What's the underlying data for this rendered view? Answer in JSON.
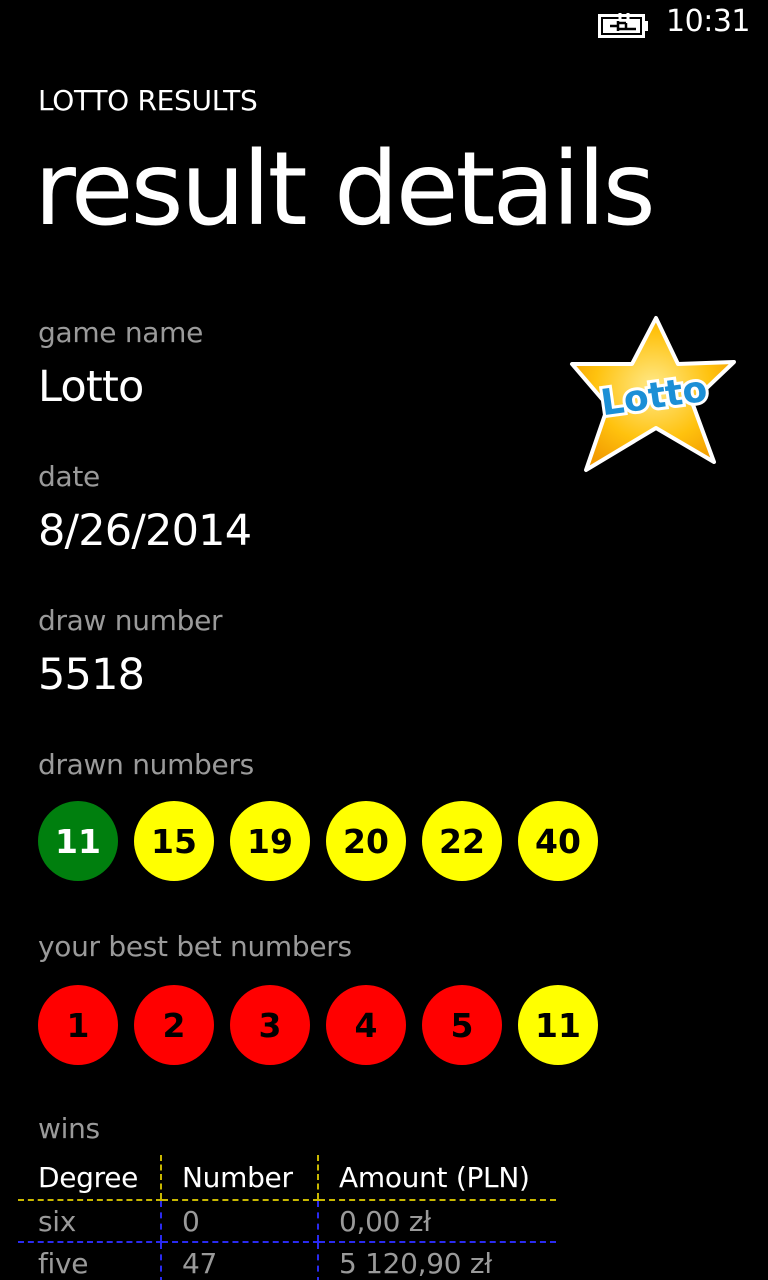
{
  "status_bar": {
    "time": "10:31",
    "battery_icon": "battery-charging-icon"
  },
  "header": {
    "app_title": "LOTTO RESULTS",
    "page_title": "result details"
  },
  "fields": {
    "game_name_label": "game name",
    "game_name_value": "Lotto",
    "date_label": "date",
    "date_value": "8/26/2014",
    "draw_number_label": "draw number",
    "draw_number_value": "5518",
    "drawn_numbers_label": "drawn numbers",
    "best_bet_label": "your best bet numbers",
    "wins_label": "wins"
  },
  "logo": {
    "text": "Lotto",
    "star_color": "#ffc20e",
    "text_color": "#1b8fd6"
  },
  "drawn_numbers": [
    {
      "value": "11",
      "color": "green"
    },
    {
      "value": "15",
      "color": "yellow"
    },
    {
      "value": "19",
      "color": "yellow"
    },
    {
      "value": "20",
      "color": "yellow"
    },
    {
      "value": "22",
      "color": "yellow"
    },
    {
      "value": "40",
      "color": "yellow"
    }
  ],
  "best_bet_numbers": [
    {
      "value": "1",
      "color": "red"
    },
    {
      "value": "2",
      "color": "red"
    },
    {
      "value": "3",
      "color": "red"
    },
    {
      "value": "4",
      "color": "red"
    },
    {
      "value": "5",
      "color": "red"
    },
    {
      "value": "11",
      "color": "yellow"
    }
  ],
  "wins_table": {
    "headers": [
      "Degree",
      "Number",
      "Amount (PLN)"
    ],
    "rows": [
      [
        "six",
        "0",
        "0,00 zł"
      ],
      [
        "five",
        "47",
        "5 120,90 zł"
      ]
    ]
  },
  "colors": {
    "green_ball": "#007f0e",
    "yellow_ball": "#ffff00",
    "red_ball": "#ff0000",
    "label_gray": "#9a9a9a"
  }
}
